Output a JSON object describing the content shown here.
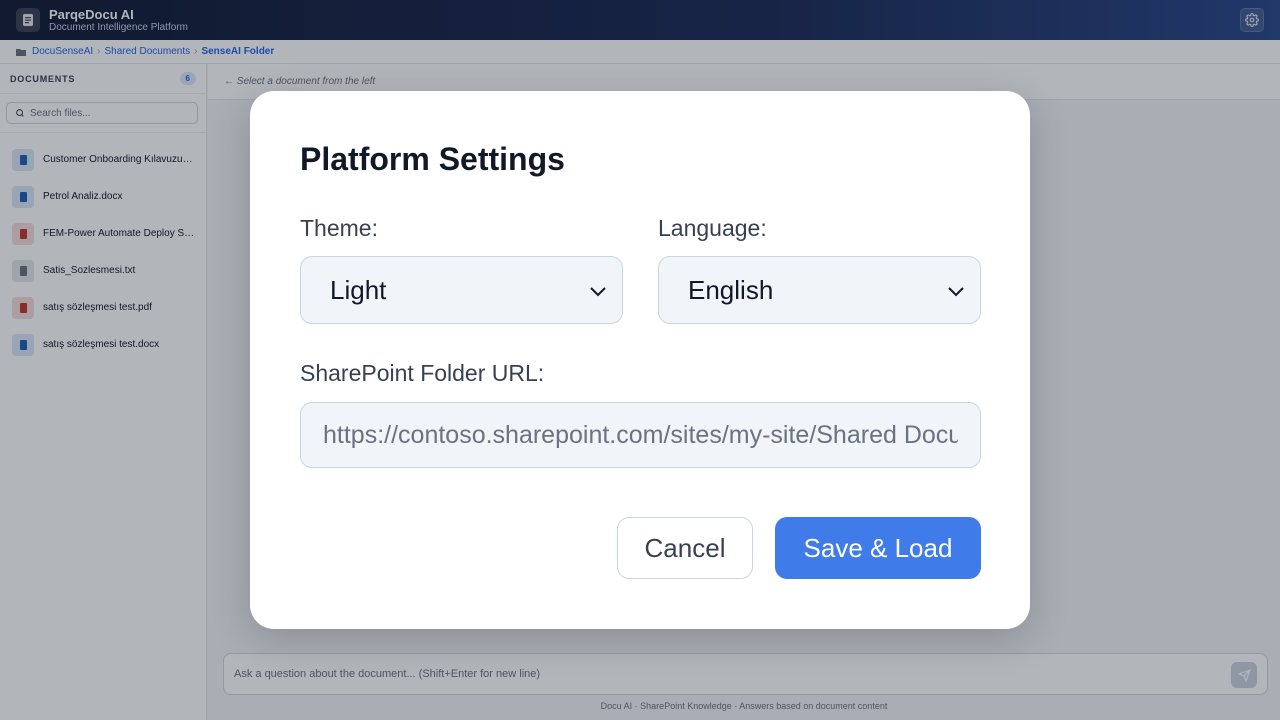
{
  "header": {
    "title": "ParqeDocu AI",
    "subtitle": "Document Intelligence Platform",
    "logo_icon": "document-icon",
    "settings_icon": "gear-icon"
  },
  "breadcrumb": {
    "items": [
      "DocuSenseAI",
      "Shared Documents",
      "SenseAI Folder"
    ],
    "separator": "›"
  },
  "sidebar": {
    "title": "DOCUMENTS",
    "count": "6",
    "search_placeholder": "Search files...",
    "files": [
      {
        "name": "Customer Onboarding Kılavuzu…",
        "type": "word",
        "color": "#1e5eb8"
      },
      {
        "name": "Petrol Analiz.docx",
        "type": "word",
        "color": "#1e5eb8"
      },
      {
        "name": "FEM-Power Automate Deploy S…",
        "type": "pdf",
        "color": "#c0392b"
      },
      {
        "name": "Satis_Sozlesmesi.txt",
        "type": "text",
        "color": "#6b7280"
      },
      {
        "name": "satış sözleşmesi test.pdf",
        "type": "pdf",
        "color": "#c0392b"
      },
      {
        "name": "satış sözleşmesi test.docx",
        "type": "word",
        "color": "#1e5eb8"
      }
    ]
  },
  "main": {
    "hint": "← Select a document from the left",
    "chat_placeholder": "Ask a question about the document... (Shift+Enter for new line)",
    "footer": "Docu AI · SharePoint Knowledge · Answers based on document content"
  },
  "modal": {
    "title": "Platform Settings",
    "theme_label": "Theme:",
    "theme_value": "Light",
    "language_label": "Language:",
    "language_value": "English",
    "url_label": "SharePoint Folder URL:",
    "url_placeholder": "https://contoso.sharepoint.com/sites/my-site/Shared Documents",
    "cancel_label": "Cancel",
    "save_label": "Save & Load"
  },
  "colors": {
    "accent": "#3f7be9",
    "link": "#2563eb"
  }
}
